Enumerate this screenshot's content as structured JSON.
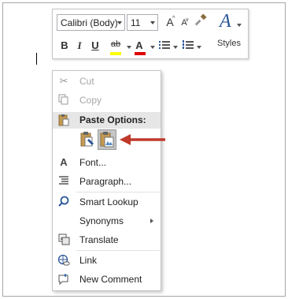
{
  "mini_toolbar": {
    "font_name": "Calibri (Body)",
    "font_size": "11",
    "grow_font_glyph": "A",
    "shrink_font_glyph": "A",
    "bold_glyph": "B",
    "italic_glyph": "I",
    "underline_glyph": "U",
    "highlight_glyph": "ab",
    "highlight_color": "#ffff00",
    "font_color_glyph": "A",
    "font_color": "#e10000",
    "styles_glyph": "A",
    "styles_label": "Styles"
  },
  "context_menu": {
    "cut": "Cut",
    "copy": "Copy",
    "paste_options": "Paste Options:",
    "font": "Font...",
    "paragraph": "Paragraph...",
    "smart_lookup": "Smart Lookup",
    "synonyms": "Synonyms",
    "translate": "Translate",
    "link": "Link",
    "new_comment": "New Comment"
  },
  "annotation": {
    "arrow_color": "#c0392b"
  }
}
